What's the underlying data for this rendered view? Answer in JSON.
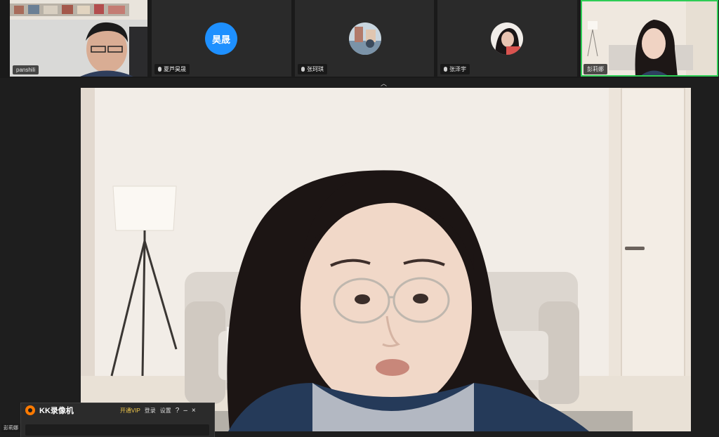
{
  "participants": [
    {
      "name": "panshili",
      "avatar": ""
    },
    {
      "name": "夏芦昊晟",
      "avatar": "昊晟"
    },
    {
      "name": "张珂琪",
      "avatar": ""
    },
    {
      "name": "张泽宇",
      "avatar": ""
    },
    {
      "name": "彭莉娜",
      "avatar": ""
    }
  ],
  "colors": {
    "avatar_blue": "#1e90ff",
    "active_border": "#2ecc55",
    "vip": "#f2c94c",
    "kk_logo": "#ff7a00"
  },
  "strip_toggle_icon": "chevron-up-icon",
  "side_label": "彭莉娜",
  "recorder": {
    "title": "KK录像机",
    "vip": "开通VIP",
    "login": "登录",
    "settings": "设置",
    "help": "?",
    "minimize": "–",
    "close": "×"
  }
}
